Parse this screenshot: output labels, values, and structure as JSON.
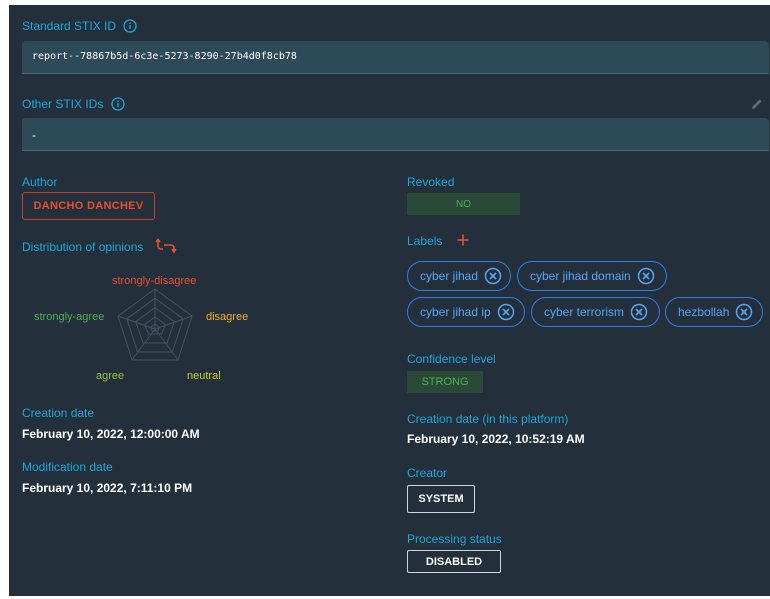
{
  "stix": {
    "standard_label": "Standard STIX ID",
    "standard_value": "report--78867b5d-6c3e-5273-8290-27b4d0f8cb78",
    "other_label": "Other STIX IDs",
    "other_value": "-"
  },
  "author": {
    "label": "Author",
    "value": "DANCHO DANCHEV"
  },
  "opinions": {
    "label": "Distribution of opinions",
    "axes": [
      "strongly-disagree",
      "disagree",
      "neutral",
      "agree",
      "strongly-agree"
    ],
    "axis_colors": [
      "#e6502f",
      "#f2b01f",
      "#c9d325",
      "#8cc63f",
      "#4cb051"
    ]
  },
  "creation": {
    "label": "Creation date",
    "value": "February 10, 2022, 12:00:00 AM"
  },
  "modification": {
    "label": "Modification date",
    "value": "February 10, 2022, 7:11:10 PM"
  },
  "revoked": {
    "label": "Revoked",
    "value": "NO"
  },
  "labels": {
    "label": "Labels",
    "items": [
      "cyber jihad",
      "cyber jihad domain",
      "cyber jihad ip",
      "cyber terrorism",
      "hezbollah"
    ]
  },
  "confidence": {
    "label": "Confidence level",
    "value": "STRONG"
  },
  "platform_creation": {
    "label": "Creation date (in this platform)",
    "value": "February 10, 2022, 10:52:19 AM"
  },
  "creator": {
    "label": "Creator",
    "value": "SYSTEM"
  },
  "processing": {
    "label": "Processing status",
    "value": "DISABLED"
  },
  "colors": {
    "panel": "#232f3a",
    "accent": "#1ba8dd",
    "author": "#e6502f",
    "success_bg": "#294a36",
    "success": "#4cb051",
    "tag": "#2e7ee8"
  }
}
